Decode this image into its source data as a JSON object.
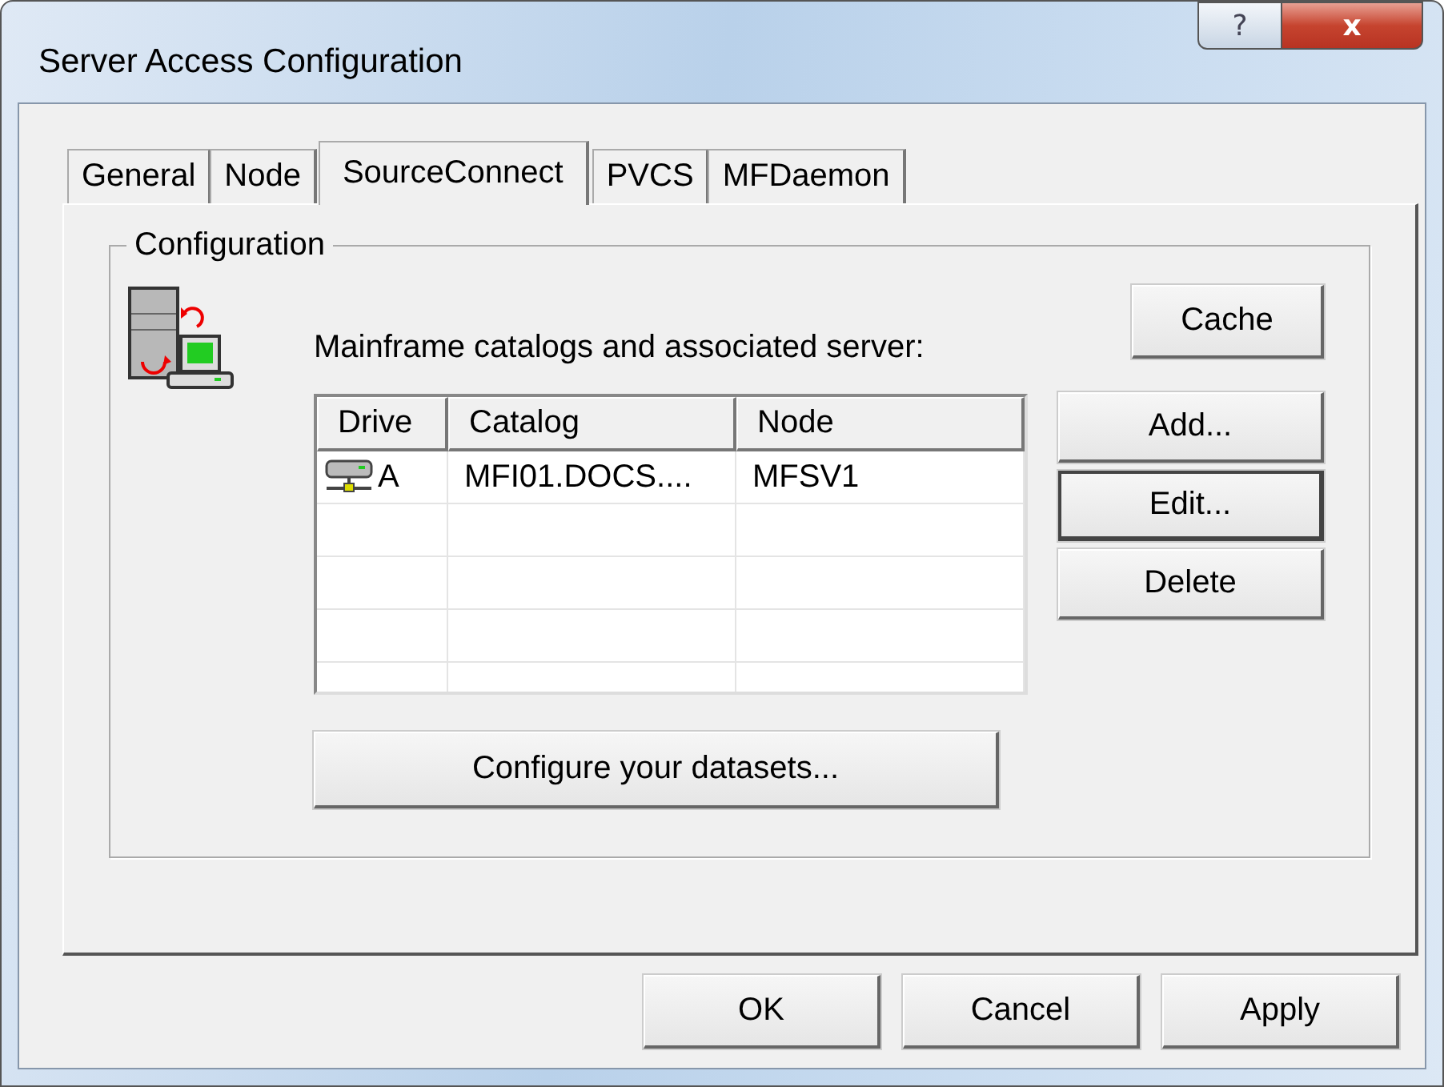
{
  "window": {
    "title": "Server Access Configuration",
    "help_button": "?",
    "close_button": "x"
  },
  "tabs": [
    {
      "label": "General",
      "selected": false
    },
    {
      "label": "Node",
      "selected": false
    },
    {
      "label": "SourceConnect",
      "selected": true
    },
    {
      "label": "PVCS",
      "selected": false
    },
    {
      "label": "MFDaemon",
      "selected": false
    }
  ],
  "group": {
    "title": "Configuration",
    "caption": "Mainframe catalogs and associated server:",
    "table": {
      "columns": [
        "Drive",
        "Catalog",
        "Node"
      ],
      "rows": [
        {
          "drive": "A",
          "catalog": "MFI01.DOCS....",
          "node": "MFSV1"
        }
      ]
    },
    "configure_button": "Configure your datasets...",
    "side_buttons": [
      {
        "label": "Cache",
        "default": false
      },
      {
        "label": "Add...",
        "default": false
      },
      {
        "label": "Edit...",
        "default": true
      },
      {
        "label": "Delete",
        "default": false
      }
    ]
  },
  "buttons": [
    "OK",
    "Cancel",
    "Apply"
  ]
}
